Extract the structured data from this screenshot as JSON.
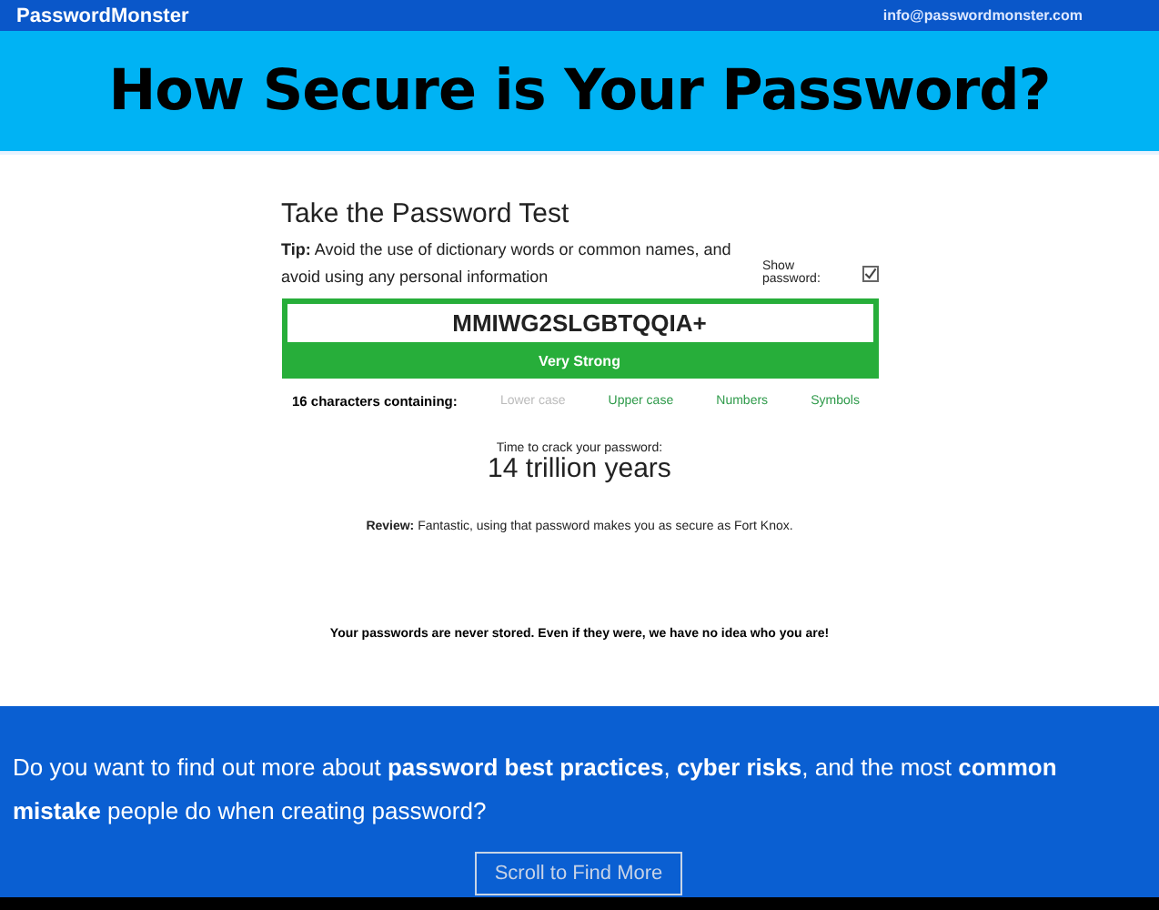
{
  "topbar": {
    "brand": "PasswordMonster",
    "email": "info@passwordmonster.com"
  },
  "banner": {
    "title": "How Secure is Your Password?"
  },
  "test": {
    "title": "Take the Password Test",
    "tip": "**Tip:** Avoid the use of dictionary words or common names, and avoid using any personal information",
    "show_password": {
      "label": "Show password:",
      "checked": true
    },
    "password": {
      "value": "MMIWG2SLGBTQQIA+"
    },
    "strength": "Very Strong",
    "characters_label": "16 characters containing:",
    "criteria": [
      {
        "label": "Lower case",
        "met": false
      },
      {
        "label": "Upper case",
        "met": true
      },
      {
        "label": "Numbers",
        "met": true
      },
      {
        "label": "Symbols",
        "met": true
      }
    ],
    "crack_label": "Time to crack your password:",
    "crack_time": "14 trillion years",
    "review": "**Review:** Fantastic, using that password makes you as secure as Fort Knox.",
    "privacy": "Your passwords are never stored. Even if they were, we have no idea who you are!"
  },
  "promo": {
    "text": "Do you want to find out more about **password best practices**, **cyber risks**, and the most **common mistake** people do when creating password?",
    "button": "Scroll to Find More"
  }
}
